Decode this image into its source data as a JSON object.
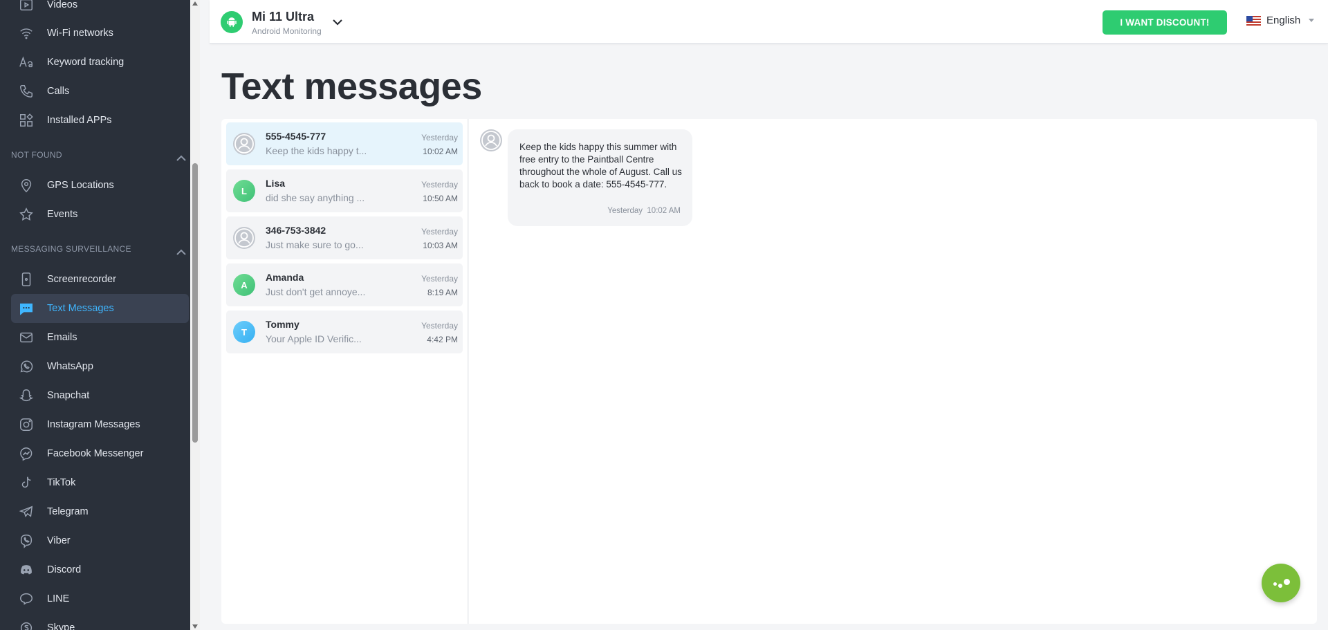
{
  "sidebar": {
    "items_top": [
      {
        "label": "Videos",
        "icon": "video-icon"
      },
      {
        "label": "Wi-Fi networks",
        "icon": "wifi-icon"
      },
      {
        "label": "Keyword tracking",
        "icon": "keyword-icon"
      },
      {
        "label": "Calls",
        "icon": "phone-icon"
      },
      {
        "label": "Installed APPs",
        "icon": "apps-icon"
      }
    ],
    "section_not_found": "NOT FOUND",
    "items_not_found": [
      {
        "label": "GPS Locations",
        "icon": "location-icon"
      },
      {
        "label": "Events",
        "icon": "star-icon"
      }
    ],
    "section_messaging": "MESSAGING SURVEILLANCE",
    "items_messaging": [
      {
        "label": "Screenrecorder",
        "icon": "screenrecorder-icon"
      },
      {
        "label": "Text Messages",
        "icon": "sms-icon",
        "active": true
      },
      {
        "label": "Emails",
        "icon": "email-icon"
      },
      {
        "label": "WhatsApp",
        "icon": "whatsapp-icon"
      },
      {
        "label": "Snapchat",
        "icon": "snapchat-icon"
      },
      {
        "label": "Instagram Messages",
        "icon": "instagram-icon"
      },
      {
        "label": "Facebook Messenger",
        "icon": "messenger-icon"
      },
      {
        "label": "TikTok",
        "icon": "tiktok-icon"
      },
      {
        "label": "Telegram",
        "icon": "telegram-icon"
      },
      {
        "label": "Viber",
        "icon": "viber-icon"
      },
      {
        "label": "Discord",
        "icon": "discord-icon"
      },
      {
        "label": "LINE",
        "icon": "line-icon"
      },
      {
        "label": "Skype",
        "icon": "skype-icon"
      }
    ]
  },
  "header": {
    "device_name": "Mi 11 Ultra",
    "device_sub": "Android Monitoring",
    "discount_label": "I WANT DISCOUNT!",
    "language": "English"
  },
  "page": {
    "title": "Text messages"
  },
  "conversations": [
    {
      "name": "555-4545-777",
      "preview": "Keep the kids happy t...",
      "date": "Yesterday",
      "time": "10:02 AM",
      "avatar": "person",
      "selected": true
    },
    {
      "name": "Lisa",
      "preview": "did she say anything ...",
      "date": "Yesterday",
      "time": "10:50 AM",
      "avatar": "L"
    },
    {
      "name": "346-753-3842",
      "preview": "Just make sure to go...",
      "date": "Yesterday",
      "time": "10:03 AM",
      "avatar": "person"
    },
    {
      "name": "Amanda",
      "preview": "Just don't get annoye...",
      "date": "Yesterday",
      "time": "8:19 AM",
      "avatar": "A"
    },
    {
      "name": "Tommy",
      "preview": "Your Apple ID Verific...",
      "date": "Yesterday",
      "time": "4:42 PM",
      "avatar": "T"
    }
  ],
  "message": {
    "text": "Keep the kids happy this summer with free entry to the Paintball Centre throughout the whole of August. Call us back to book a date: 555-4545-777.",
    "date": "Yesterday",
    "time": "10:02 AM"
  },
  "colors": {
    "accent": "#2ecc71",
    "sidebar": "#2a303a",
    "active_text": "#3fb6ff",
    "fab": "#7cbf3a"
  }
}
